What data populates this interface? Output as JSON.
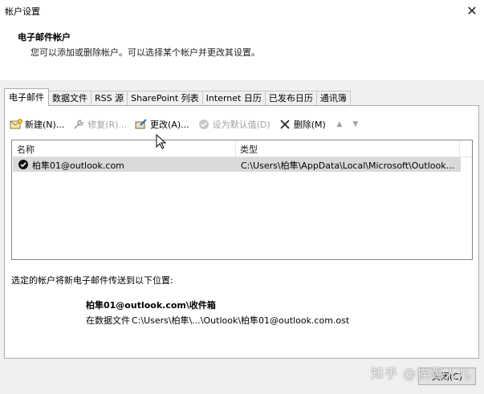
{
  "window": {
    "title": "帐户设置"
  },
  "header": {
    "title": "电子邮件帐户",
    "description": "您可以添加或删除帐户。可以选择某个帐户并更改其设置。"
  },
  "tabs": [
    {
      "label": "电子邮件",
      "active": true
    },
    {
      "label": "数据文件"
    },
    {
      "label": "RSS 源"
    },
    {
      "label": "SharePoint 列表"
    },
    {
      "label": "Internet 日历"
    },
    {
      "label": "已发布日历"
    },
    {
      "label": "通讯簿"
    }
  ],
  "toolbar": {
    "new_label": "新建(N)...",
    "repair_label": "修复(R)...",
    "change_label": "更改(A)...",
    "default_label": "设为默认值(D)",
    "remove_label": "删除(M)"
  },
  "list": {
    "columns": [
      "名称",
      "类型"
    ],
    "rows": [
      {
        "name": "柏隼01@outlook.com",
        "type": "C:\\Users\\柏隼\\AppData\\Local\\Microsoft\\Outlook..."
      }
    ]
  },
  "delivery": {
    "label": "选定的帐户将新电子邮件传送到以下位置:",
    "folder": "柏隼01@outlook.com\\收件箱",
    "path_label": "在数据文件",
    "path": "C:\\Users\\柏隼\\...\\Outlook\\柏隼01@outlook.com.ost"
  },
  "footer": {
    "close_label": "关闭(C)"
  },
  "watermark": "知乎 @挨踢人儿",
  "colors": {
    "selected_row": "#d9d9d9",
    "panel_bg": "#f0f0f0",
    "check": "#000000"
  }
}
